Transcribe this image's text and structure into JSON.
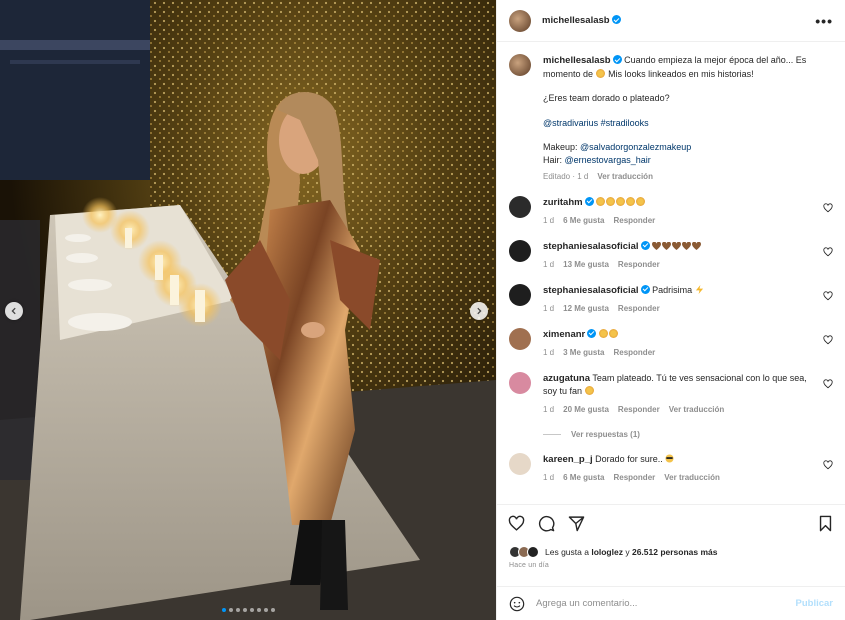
{
  "post": {
    "author": "michellesalasb",
    "photo_dots": 8,
    "photo_active_dot": 0
  },
  "caption": {
    "author": "michellesalasb",
    "line1": "Cuando empieza la mejor época del año... Es momento de",
    "line1b": "Mis looks linkeados en mis historias!",
    "question": "¿Eres team dorado o plateado?",
    "tags": "@stradivarius #stradilooks",
    "makeup_label": "Makeup:",
    "makeup_mention": "@salvadorgonzalezmakeup",
    "hair_label": "Hair:",
    "hair_mention": "@ernestovargas_hair",
    "edited": "Editado · 1 d",
    "translate": "Ver traducción"
  },
  "comments": [
    {
      "user": "zuritahm",
      "verified": true,
      "text": "",
      "emojis": "stars5",
      "time": "1 d",
      "likes": "6 Me gusta",
      "reply": "Responder",
      "translate": ""
    },
    {
      "user": "stephaniesalasoficial",
      "verified": true,
      "text": "",
      "emojis": "hearts5",
      "time": "1 d",
      "likes": "13 Me gusta",
      "reply": "Responder",
      "translate": ""
    },
    {
      "user": "stephaniesalasoficial",
      "verified": true,
      "text": "Padrisima",
      "emojis": "bolt",
      "time": "1 d",
      "likes": "12 Me gusta",
      "reply": "Responder",
      "translate": ""
    },
    {
      "user": "ximenanr",
      "verified": true,
      "text": "",
      "emojis": "stars2",
      "time": "1 d",
      "likes": "3 Me gusta",
      "reply": "Responder",
      "translate": ""
    },
    {
      "user": "azugatuna",
      "verified": false,
      "text": "Team plateado. Tú te ves sensacional con lo que sea, soy tu fan",
      "emojis": "face",
      "time": "1 d",
      "likes": "20 Me gusta",
      "reply": "Responder",
      "translate": "Ver traducción"
    },
    {
      "user": "kareen_p_j",
      "verified": false,
      "text": "Dorado for sure..",
      "emojis": "face2",
      "time": "1 d",
      "likes": "6 Me gusta",
      "reply": "Responder",
      "translate": "Ver traducción"
    }
  ],
  "view_replies": "Ver respuestas (1)",
  "likes_line": {
    "prefix": "Les gusta a",
    "user": "lologlez",
    "joiner": "y",
    "count": "26.512 personas más"
  },
  "posted": "Hace un día",
  "add_comment": {
    "placeholder": "Agrega un comentario...",
    "publish": "Publicar"
  },
  "colors": {
    "accent": "#0095f6",
    "text": "#262626",
    "muted": "#8e8e8e",
    "publish_disabled": "#b2dffc"
  }
}
